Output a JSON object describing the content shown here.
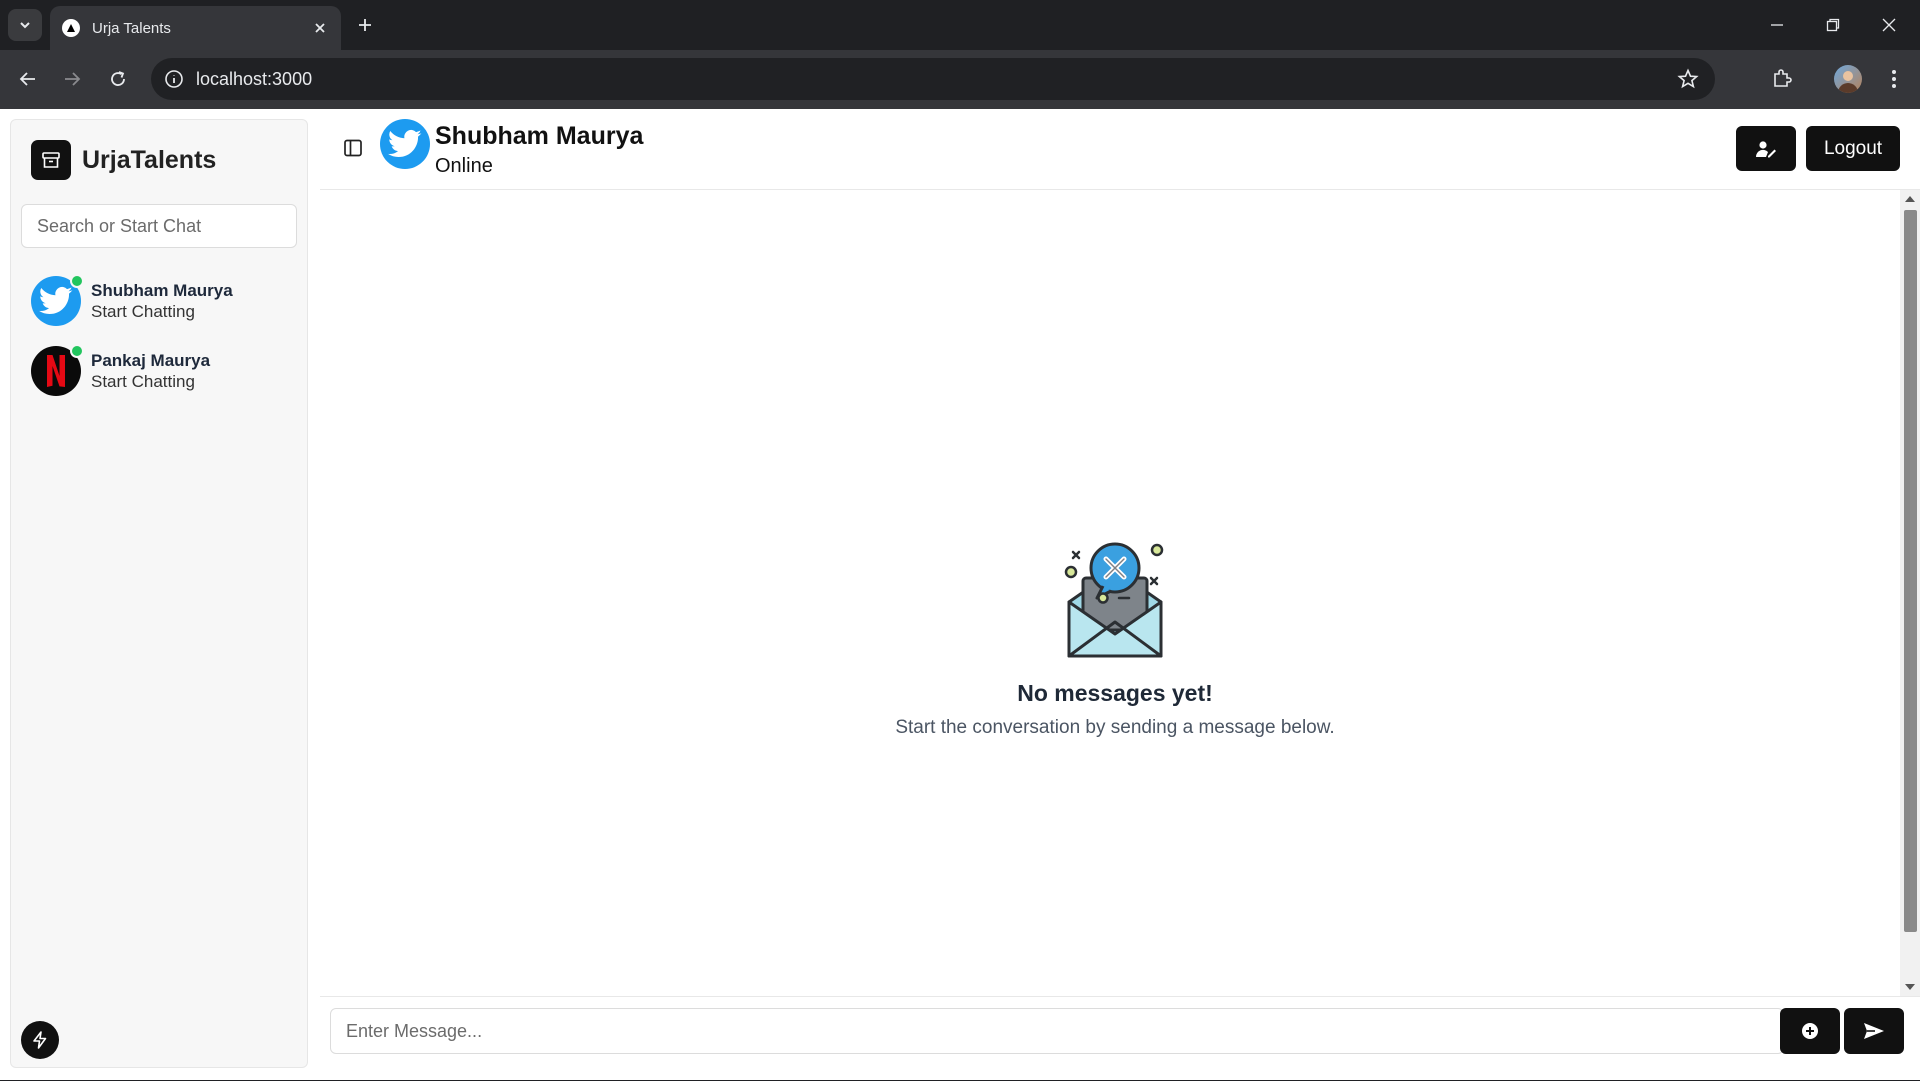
{
  "browser": {
    "tab_title": "Urja Talents",
    "url": "localhost:3000"
  },
  "app": {
    "brand_name": "UrjaTalents",
    "search_placeholder": "Search or Start Chat"
  },
  "contacts": [
    {
      "name": "Shubham Maurya",
      "subtitle": "Start Chatting",
      "online": true,
      "avatar": "twitter-logo"
    },
    {
      "name": "Pankaj Maurya",
      "subtitle": "Start Chatting",
      "online": true,
      "avatar": "netflix-logo"
    }
  ],
  "chat": {
    "name": "Shubham Maurya",
    "status": "Online",
    "logout_label": "Logout",
    "empty_title": "No messages yet!",
    "empty_subtitle": "Start the conversation by sending a message below.",
    "message_placeholder": "Enter Message..."
  },
  "colors": {
    "accent_dark": "#111111",
    "online": "#22c55e",
    "twitter_blue": "#1d9bf0",
    "netflix_red": "#e50914"
  }
}
